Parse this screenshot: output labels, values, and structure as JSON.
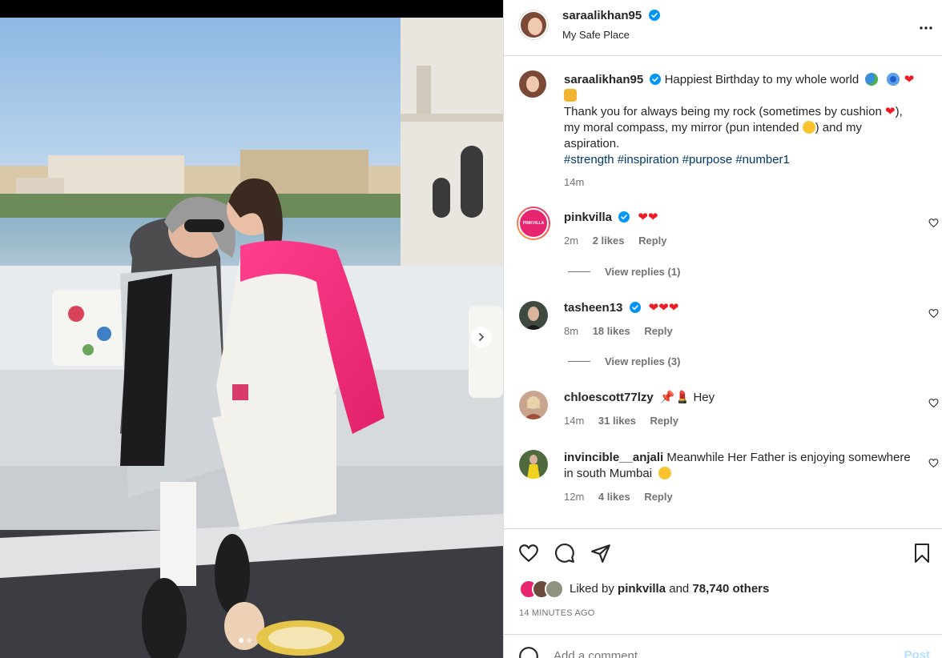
{
  "post": {
    "author": "saraalikhan95",
    "location": "My Safe Place",
    "more_icon": "more-horizontal-icon"
  },
  "caption": {
    "author": "saraalikhan95",
    "line1": "Happiest Birthday to my whole world",
    "line2": "Thank you for always being my rock (sometimes by cushion",
    "line2b": "),",
    "line3": "my moral compass, my mirror (pun intended",
    "line3b": ") and my",
    "line4": "aspiration.",
    "hashtags": [
      "#strength",
      "#inspiration",
      "#purpose",
      "#number1"
    ],
    "time": "14m"
  },
  "comments": [
    {
      "user": "pinkvilla",
      "verified": true,
      "text": "",
      "time": "2m",
      "likes": "2 likes",
      "reply": "Reply",
      "view_replies": "View replies (1)"
    },
    {
      "user": "tasheen13",
      "verified": true,
      "text": "",
      "time": "8m",
      "likes": "18 likes",
      "reply": "Reply",
      "view_replies": "View replies (3)"
    },
    {
      "user": "chloescott77lzy",
      "verified": false,
      "text": "Hey",
      "time": "14m",
      "likes": "31 likes",
      "reply": "Reply"
    },
    {
      "user": "invincible__anjali",
      "verified": false,
      "text": "Meanwhile Her Father is enjoying somewhere",
      "text2": "in south Mumbai",
      "time": "12m",
      "likes": "4 likes",
      "reply": "Reply"
    }
  ],
  "likes": {
    "prefix": "Liked by",
    "user": "pinkvilla",
    "and": "and",
    "others": "78,740 others"
  },
  "timestamp": "14 MINUTES AGO",
  "add_comment": {
    "placeholder": "Add a comment…",
    "post_label": "Post"
  },
  "pinkvilla_logo_text": "PINKVILLA",
  "colors": {
    "verified_blue": "#0095f6",
    "hashtag": "#00376b",
    "muted": "#737373",
    "heart_red": "#ed1c24",
    "pink_brand": "#e8256f"
  }
}
